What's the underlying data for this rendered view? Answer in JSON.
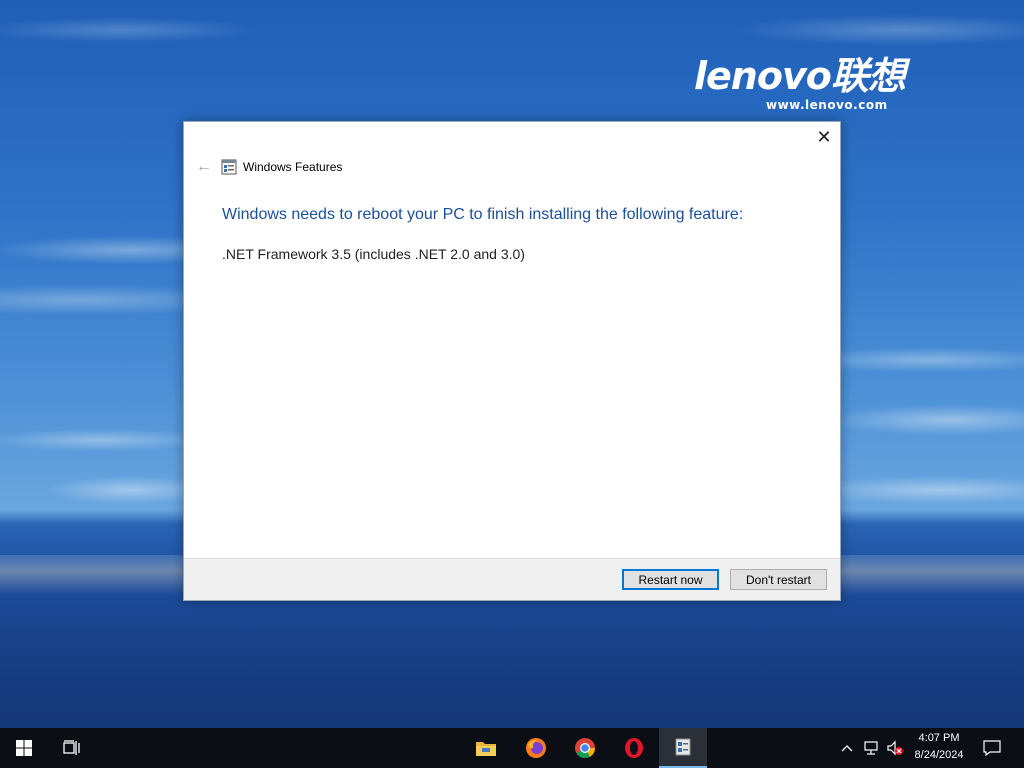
{
  "desktop": {
    "brand_logo": "lenovo联想",
    "brand_url": "www.lenovo.com"
  },
  "dialog": {
    "title": "Windows Features",
    "close_glyph": "✕",
    "back_glyph": "←",
    "main_instruction": "Windows needs to reboot your PC to finish installing the following feature:",
    "feature": ".NET Framework 3.5 (includes .NET 2.0 and 3.0)",
    "restart_label": "Restart now",
    "dont_restart_label": "Don't restart"
  },
  "taskbar": {
    "icons": [
      "windows-start-icon",
      "task-view-icon",
      "file-explorer-icon",
      "firefox-icon",
      "chrome-icon",
      "opera-icon",
      "windows-features-icon",
      "chevron-up-icon",
      "network-icon",
      "volume-muted-icon",
      "notification-icon"
    ],
    "tray_chevron": "^",
    "time": "4:07 PM",
    "date": "8/24/2024"
  },
  "colors": {
    "instruction_blue": "#1b4f9c",
    "taskbar": "#0b0e14",
    "accent": "#0078d7"
  }
}
